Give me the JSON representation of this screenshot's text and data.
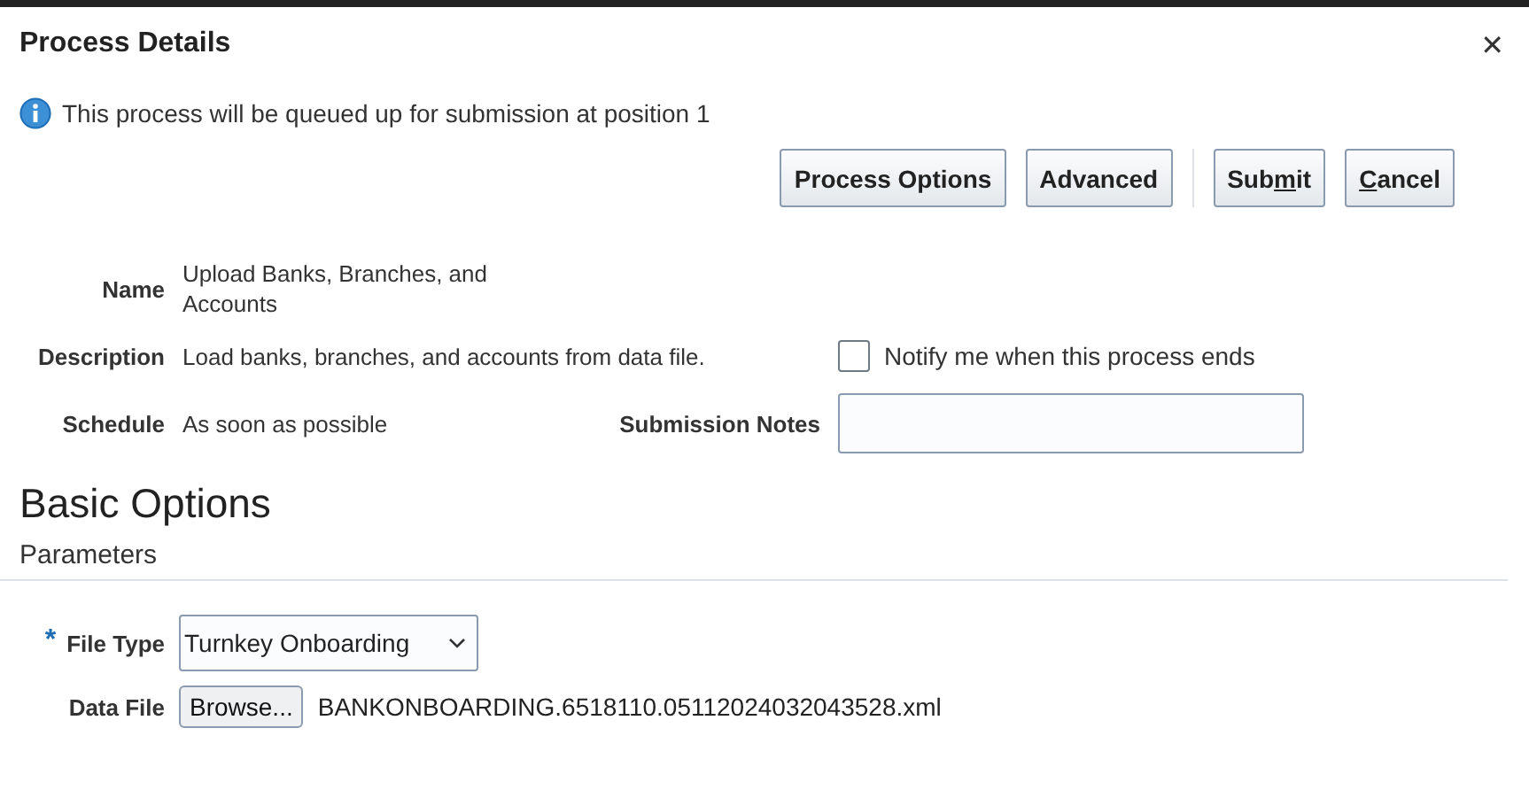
{
  "dialog": {
    "title": "Process Details",
    "close": "✕"
  },
  "info": "This process will be queued up for submission at position 1",
  "buttons": [
    {
      "label": "Process Options"
    },
    {
      "label": "Advanced"
    },
    {
      "before": "Sub",
      "key": "m",
      "after": "it"
    },
    {
      "key": "C",
      "after": "ancel"
    }
  ],
  "details": {
    "name_label": "Name",
    "name": "Upload Banks, Branches, and Accounts",
    "description_label": "Description",
    "description": "Load banks, branches, and accounts from data file.",
    "notify": {
      "label": "Notify me when this process ends",
      "checked": false
    },
    "schedule_label": "Schedule",
    "schedule": "As soon as possible",
    "notes_label": "Submission Notes"
  },
  "section_title": "Basic Options",
  "subsection_title": "Parameters",
  "parameters": [
    {
      "kind": "select",
      "required_mark": "*",
      "label": "File Type",
      "value": "Turnkey Onboarding"
    },
    {
      "kind": "file",
      "label": "Data File",
      "button": "Browse...",
      "value": "BANKONBOARDING.6518110.05112024032043528.xml"
    }
  ]
}
